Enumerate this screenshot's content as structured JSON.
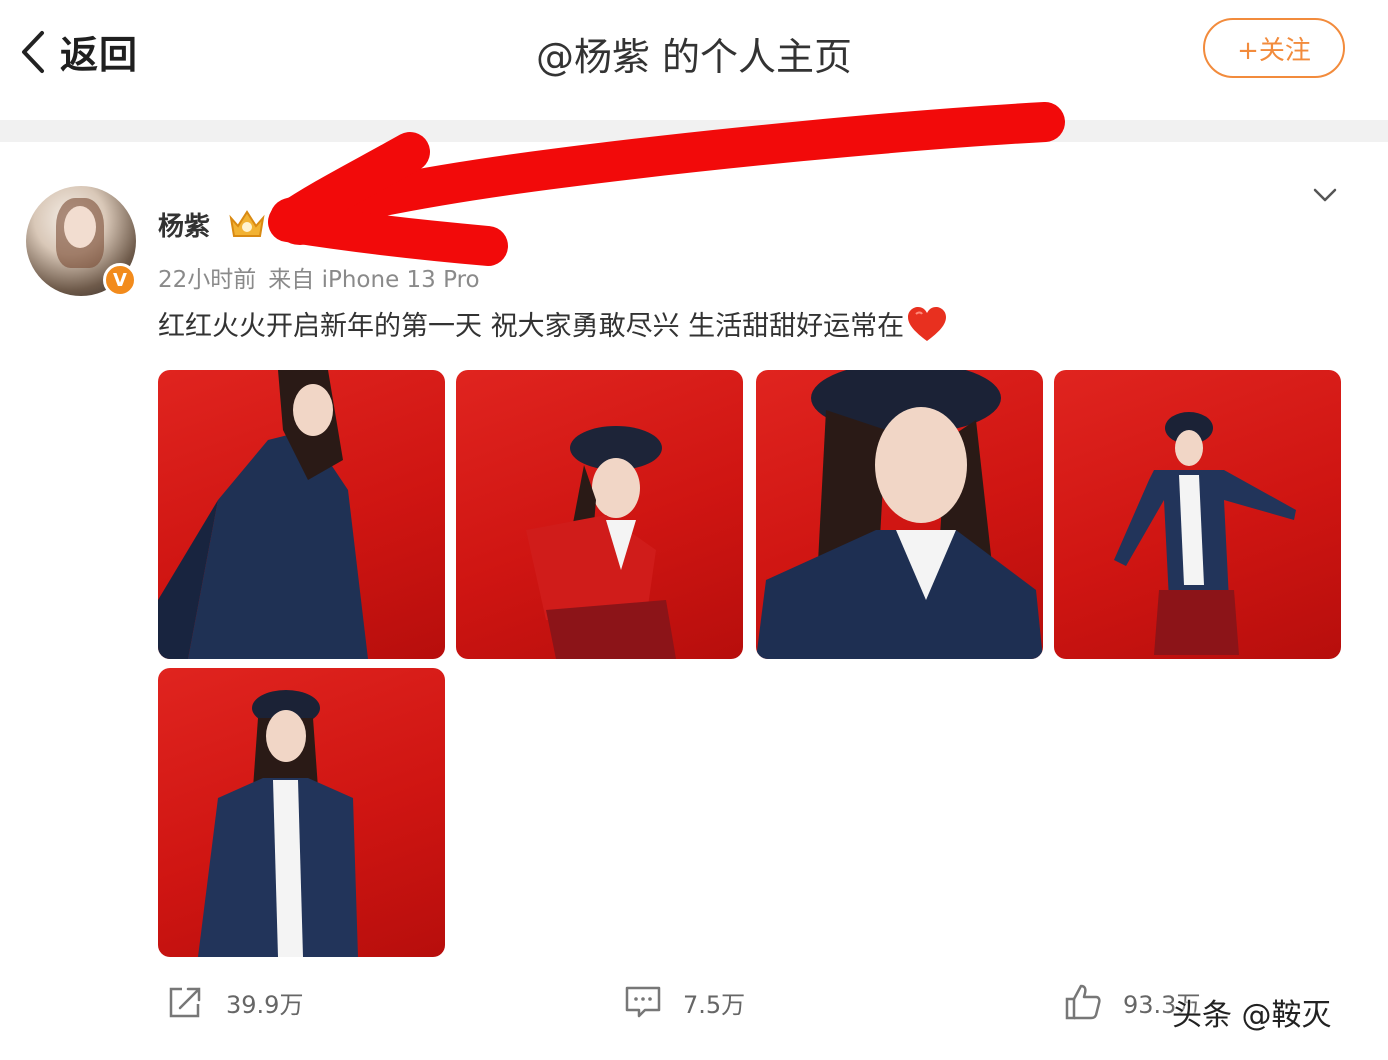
{
  "header": {
    "back_label": "返回",
    "title": "@杨紫 的个人主页",
    "follow_label": "+关注"
  },
  "post": {
    "author": "杨紫",
    "time": "22小时前",
    "source": "来自 iPhone 13 Pro",
    "verified_badge": "V",
    "text": "红红火火开启新年的第一天 祝大家勇敢尽兴 生活甜甜好运常在",
    "images": [
      {
        "name": "photo-1"
      },
      {
        "name": "photo-2"
      },
      {
        "name": "photo-3"
      },
      {
        "name": "photo-4"
      },
      {
        "name": "photo-5"
      }
    ]
  },
  "actions": {
    "repost_count": "39.9万",
    "comment_count": "7.5万",
    "like_count": "93.3万"
  },
  "watermark": "头条 @鞍灭",
  "colors": {
    "accent": "#f28b3c",
    "annotation": "#f20a0a",
    "photo_background": "#d41a16",
    "badge": "#f28b1c"
  },
  "icons": [
    "back-icon",
    "crown-icon",
    "chevron-down-icon",
    "heart-icon",
    "repost-icon",
    "comment-icon",
    "like-icon"
  ]
}
